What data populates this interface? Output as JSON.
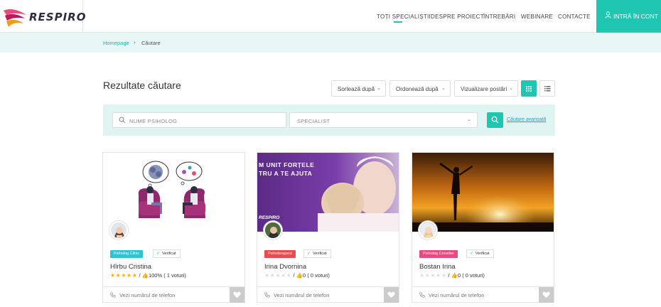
{
  "brand": {
    "name": "RESPIRO"
  },
  "nav": {
    "items": [
      {
        "label": "TOȚI SPECIALIȘTII"
      },
      {
        "label": "DESPRE PROIECT"
      },
      {
        "label": "ÎNTREBĂRI"
      },
      {
        "label": "WEBINARE"
      },
      {
        "label": "CONTACTE"
      }
    ],
    "login_label": "INTRĂ ÎN CONT"
  },
  "breadcrumb": {
    "home": "Homepage",
    "separator": "›",
    "current": "Căutare"
  },
  "results": {
    "title": "Rezultate căutare",
    "sort_label": "Sortează după",
    "order_label": "Ordonează după",
    "view_label": "Vizualizare postări"
  },
  "search": {
    "name_placeholder": "NUME PSIHOLOG",
    "specialist_placeholder": "SPECIALIST",
    "advanced_link": "Căutare avansată"
  },
  "cards": [
    {
      "tag": "Psiholog Clinic",
      "tag_color": "#2ec4d6",
      "verified": "Verificat",
      "name": "Hîrbu Cristina",
      "stars": "★★★★★",
      "stars_color": "#f5b400",
      "rating_text": "/ 👍100% ( 1 voturi)",
      "phone": "Vezi numărul de telefon"
    },
    {
      "tag": "Psihoterapeut",
      "tag_color": "#e84c4c",
      "verified": "Verificat",
      "name": "Irina Dvornina",
      "stars": "★★★★★",
      "stars_color": "#dddddd",
      "rating_text": "/ 👍0 ( 0 voturi)",
      "phone": "Vezi numărul de telefon",
      "banner_line1": "M UNIT FORȚELE",
      "banner_line2": "TRU A TE AJUTA",
      "banner_brand": "RESPIRO"
    },
    {
      "tag": "Psiholog Consilier",
      "tag_color": "#e84a7f",
      "verified": "Verificat",
      "name": "Bostan Irina",
      "stars": "★★★★★",
      "stars_color": "#dddddd",
      "rating_text": "/ 👍0 ( 0 voturi)",
      "phone": "Vezi numărul de telefon"
    }
  ],
  "colors": {
    "accent": "#1fc6b2",
    "light_band": "#e8f7f5",
    "search_band": "#e0f5f2",
    "link": "#1a9fd1"
  }
}
